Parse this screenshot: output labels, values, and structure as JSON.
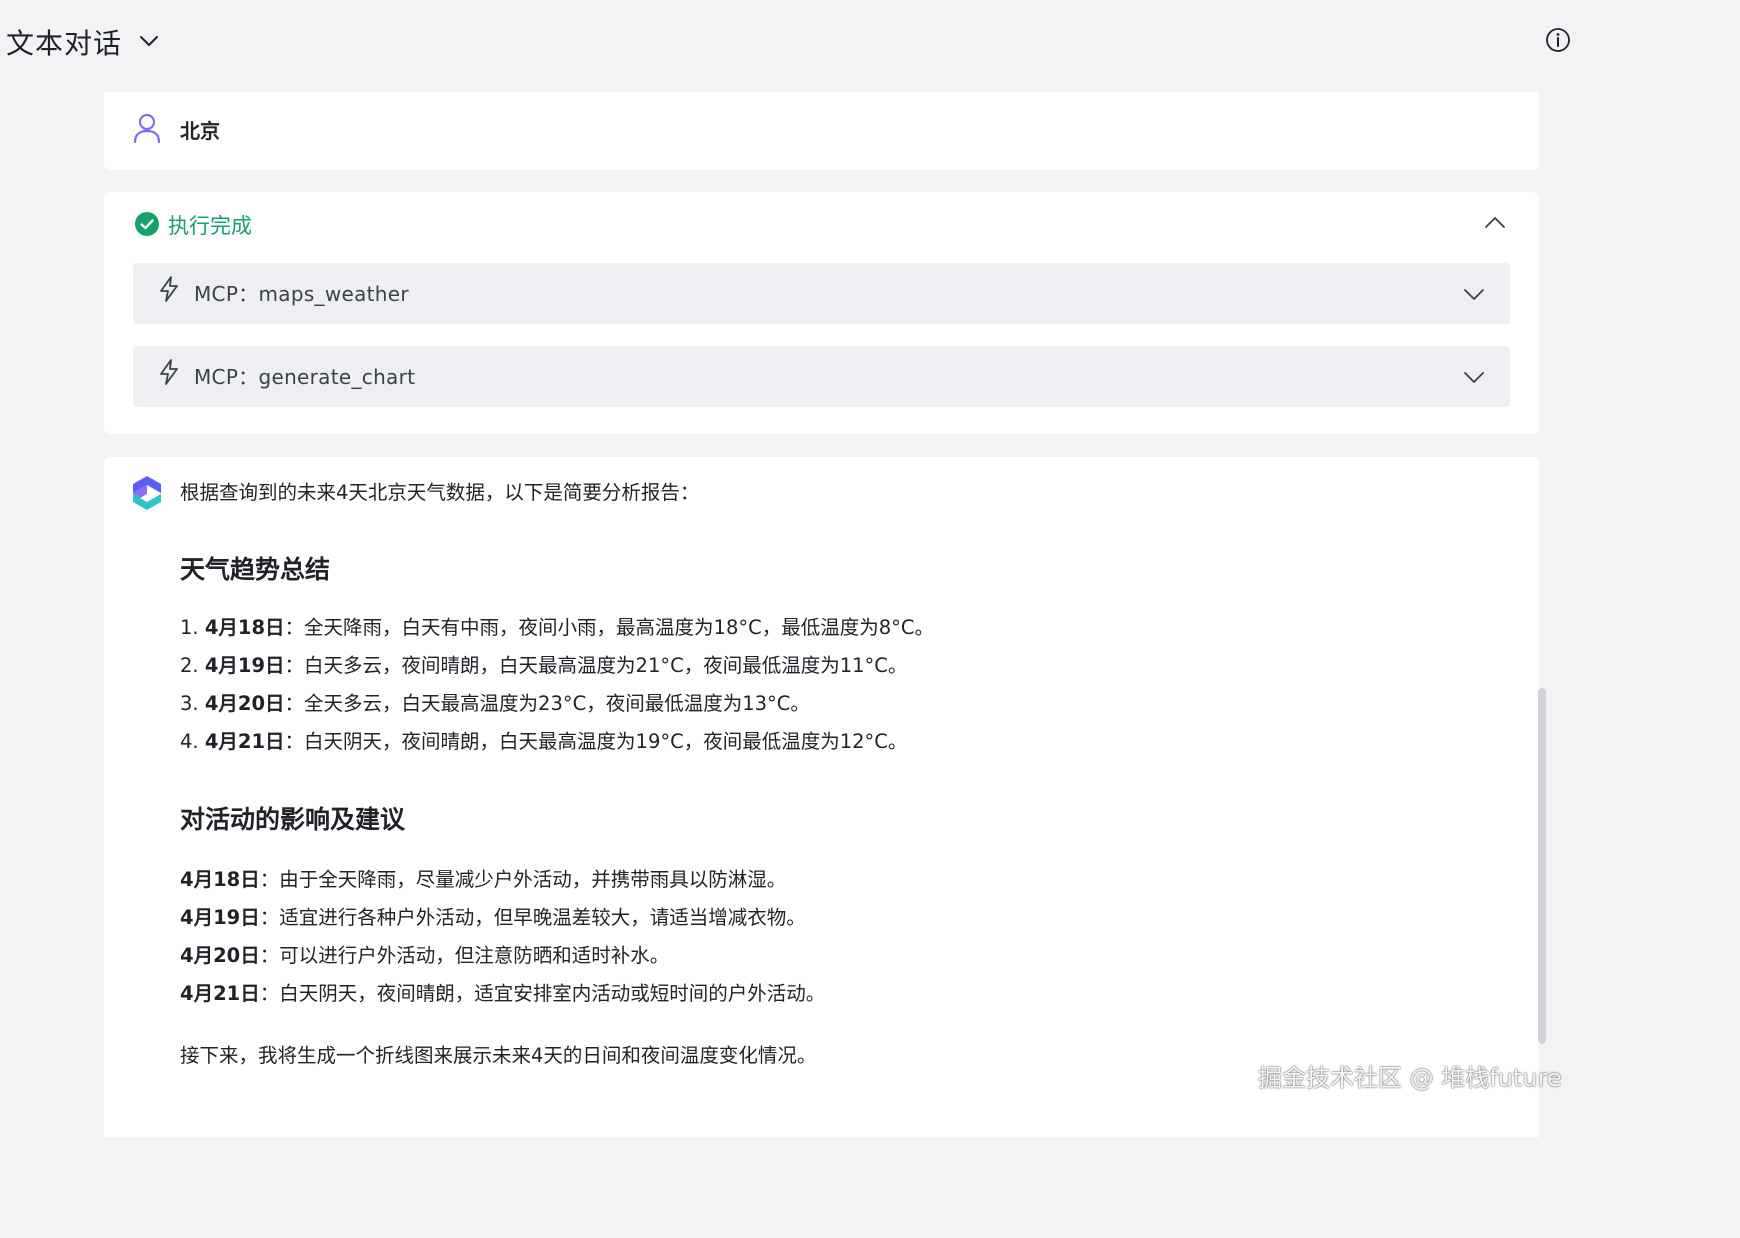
{
  "header": {
    "title": "文本对话",
    "chevron_icon": "chevron-down-icon",
    "info_icon": "info-icon"
  },
  "user_message": {
    "icon": "user-icon",
    "text": "北京"
  },
  "execution": {
    "status": "执行完成",
    "status_icon": "check-circle-icon",
    "status_color": "#16a06a",
    "tools": [
      {
        "label": "MCP：maps_weather",
        "icon": "bolt-icon"
      },
      {
        "label": "MCP：generate_chart",
        "icon": "bolt-icon"
      }
    ]
  },
  "answer": {
    "logo": "bot-logo-icon",
    "intro": "根据查询到的未来4天北京天气数据，以下是简要分析报告：",
    "section1_title": "天气趋势总结",
    "trend_items": [
      {
        "num": "1.",
        "date": "4月18日",
        "text": "：全天降雨，白天有中雨，夜间小雨，最高温度为18°C，最低温度为8°C。"
      },
      {
        "num": "2.",
        "date": "4月19日",
        "text": "：白天多云，夜间晴朗，白天最高温度为21°C，夜间最低温度为11°C。"
      },
      {
        "num": "3.",
        "date": "4月20日",
        "text": "：全天多云，白天最高温度为23°C，夜间最低温度为13°C。"
      },
      {
        "num": "4.",
        "date": "4月21日",
        "text": "：白天阴天，夜间晴朗，白天最高温度为19°C，夜间最低温度为12°C。"
      }
    ],
    "section2_title": "对活动的影响及建议",
    "advice_items": [
      {
        "date": "4月18日",
        "text": "：由于全天降雨，尽量减少户外活动，并携带雨具以防淋湿。"
      },
      {
        "date": "4月19日",
        "text": "：适宜进行各种户外活动，但早晚温差较大，请适当增减衣物。"
      },
      {
        "date": "4月20日",
        "text": "：可以进行户外活动，但注意防晒和适时补水。"
      },
      {
        "date": "4月21日",
        "text": "：白天阴天，夜间晴朗，适宜安排室内活动或短时间的户外活动。"
      }
    ],
    "closing": "接下来，我将生成一个折线图来展示未来4天的日间和夜间温度变化情况。"
  },
  "watermark": "掘金技术社区 @ 堆栈future"
}
